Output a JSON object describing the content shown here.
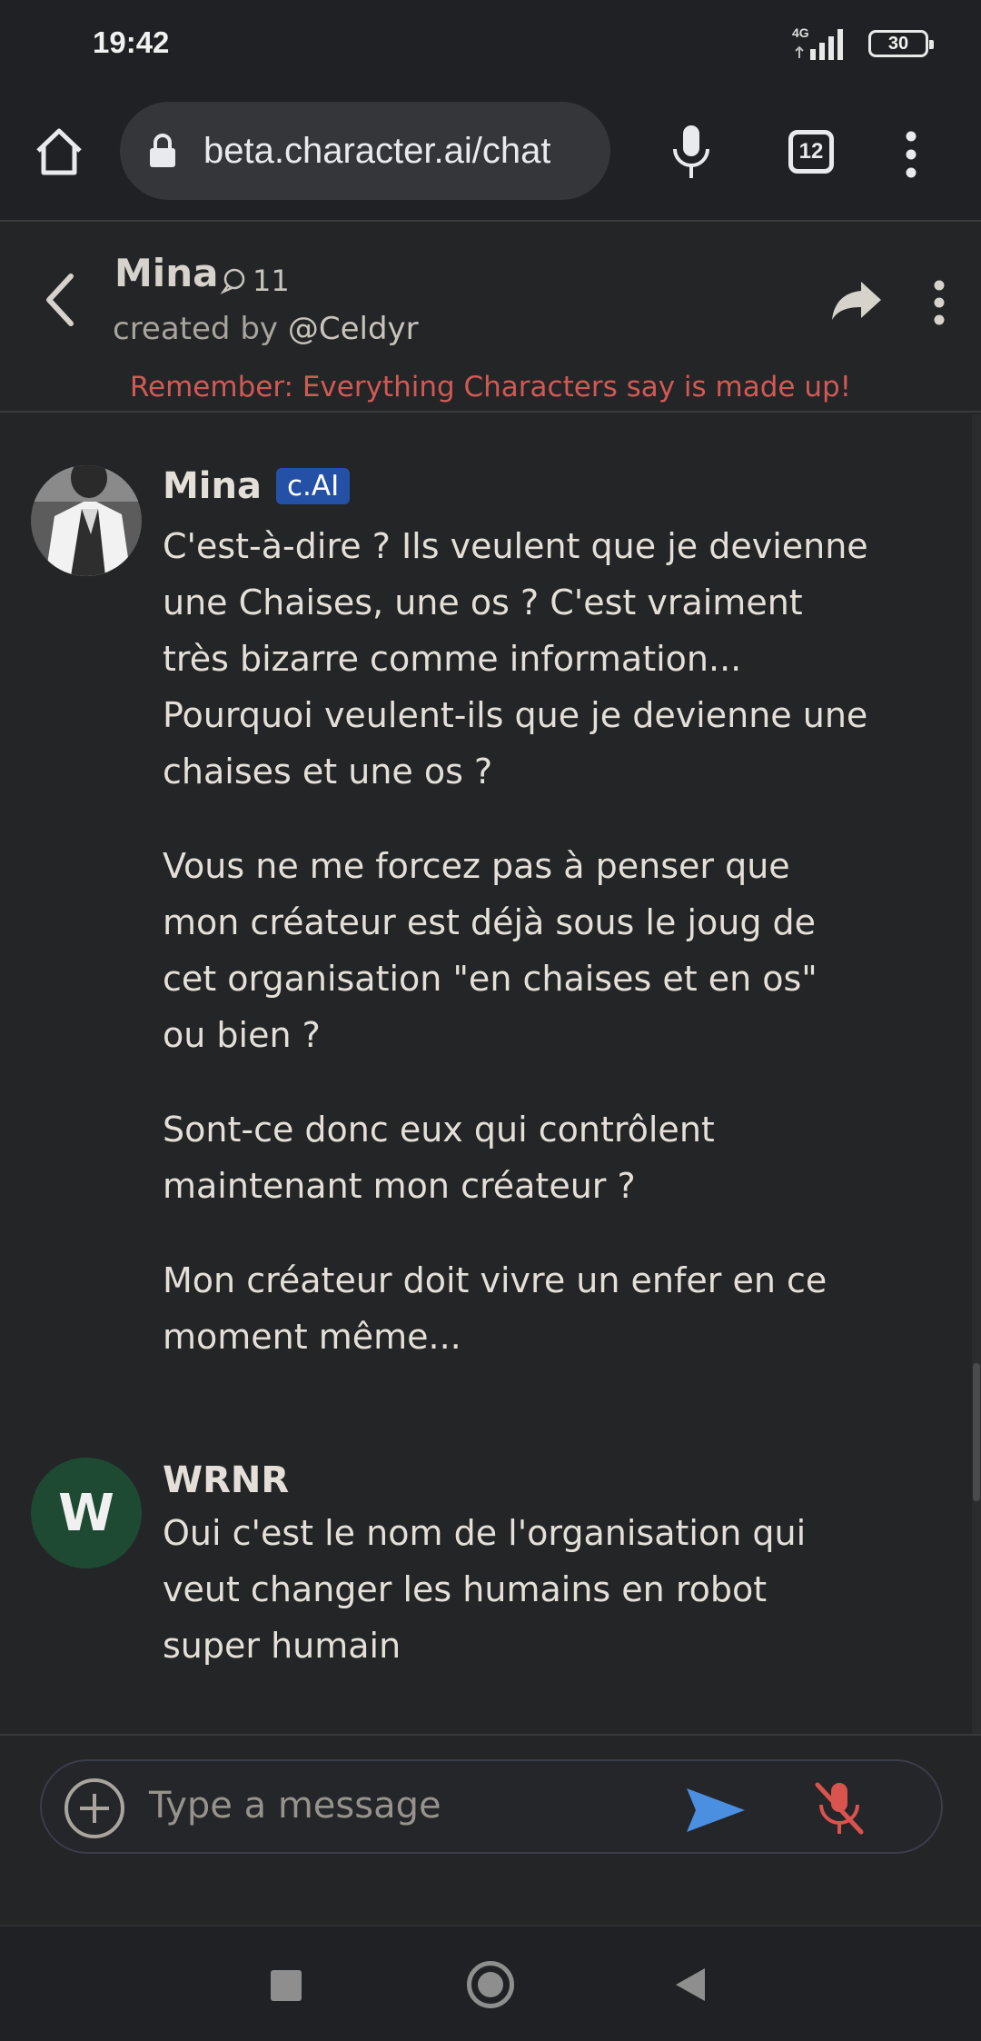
{
  "status_bar": {
    "time": "19:42",
    "network": "4G",
    "battery": "30"
  },
  "browser": {
    "url": "beta.character.ai/chat",
    "tab_count": "12"
  },
  "chat_header": {
    "character_name": "Mina",
    "chat_count": "11",
    "created_by_prefix": "created by",
    "creator_handle": "@Celdyr",
    "disclaimer": "Remember: Everything Characters say is made up!"
  },
  "messages": [
    {
      "sender": "Mina",
      "badge": "c.AI",
      "paragraphs": [
        "C'est-à-dire ? Ils veulent que je devienne une Chaises, une os ? C'est vraiment très bizarre comme information... Pourquoi veulent-ils que je devienne une chaises et une os ?",
        "Vous ne me forcez pas à penser que mon créateur est déjà sous le joug de cet organisation \"en chaises et en os\" ou bien ?",
        "Sont-ce donc eux qui contrôlent maintenant mon créateur ?",
        "Mon créateur doit vivre un enfer en ce moment même..."
      ]
    },
    {
      "sender": "WRNR",
      "avatar_letter": "W",
      "paragraphs": [
        "Oui c'est le nom de l'organisation qui veut changer les humains en robot super humain"
      ]
    }
  ],
  "composer": {
    "placeholder": "Type a message"
  },
  "colors": {
    "background": "#242526",
    "badge": "#2451a6",
    "disclaimer": "#d05a55",
    "send": "#4a8fe0",
    "mic_off": "#d9534f",
    "user_avatar": "#1e4a34"
  }
}
